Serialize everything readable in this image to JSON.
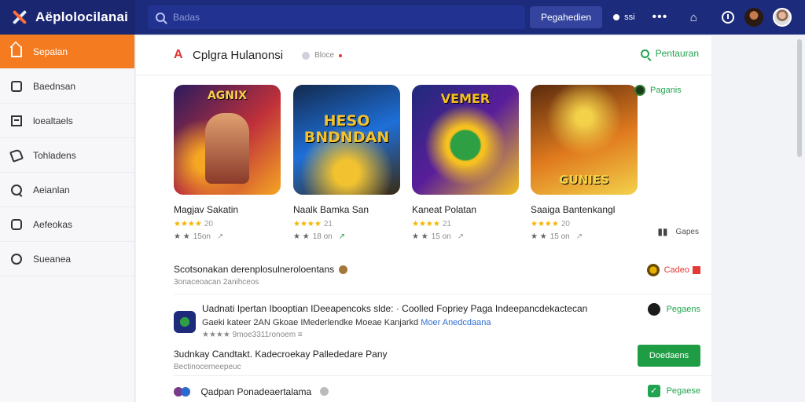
{
  "app": {
    "title": "Aëplolocilanai"
  },
  "search": {
    "placeholder": "Badas"
  },
  "topbar": {
    "primary_button": "Pegahedien",
    "status_text": "ssi",
    "more": "•••"
  },
  "sidebar": {
    "items": [
      {
        "label": "Sepalan",
        "icon": "home-icon",
        "active": true
      },
      {
        "label": "Baednsan",
        "icon": "grid-icon"
      },
      {
        "label": "loealtaels",
        "icon": "box-icon"
      },
      {
        "label": "Tohladens",
        "icon": "tag-icon"
      },
      {
        "label": "Aeianlan",
        "icon": "search-icon"
      },
      {
        "label": "Aefeokas",
        "icon": "pin-icon"
      },
      {
        "label": "Sueanea",
        "icon": "coin-icon"
      }
    ]
  },
  "panel": {
    "title": "Cplgra Hulanonsi",
    "sort_label": "Bloce",
    "header_link": "Pentauran",
    "right_badge": "Paganis",
    "right_meta": "Gapes"
  },
  "cards": [
    {
      "image_text": "AGNIX",
      "title": "Magjav Sakatin",
      "rating": "★★★★",
      "rating_text": "20",
      "meta": "15on",
      "colors": [
        "#2a1b5e",
        "#c0303a",
        "#f5a623"
      ]
    },
    {
      "image_text": "HESO BNDNDAN",
      "title": "Naalk Bamka San",
      "rating": "★★★★",
      "rating_text": "21",
      "meta": "18 on",
      "colors": [
        "#132a4d",
        "#1e6fd9",
        "#f2c230"
      ]
    },
    {
      "image_text": "VEMER",
      "title": "Kaneat Polatan",
      "rating": "★★★★",
      "rating_text": "21",
      "meta": "15 on",
      "colors": [
        "#1e2a7a",
        "#2ea043",
        "#f5c020"
      ]
    },
    {
      "image_text": "GUNIES",
      "title": "Saaiga Bantenkangl",
      "rating": "★★★★",
      "rating_text": "20",
      "meta": "15 on",
      "colors": [
        "#5a2a0e",
        "#e07a1e",
        "#f3d24a"
      ]
    }
  ],
  "section": {
    "title": "Scotsonakan derenplosulneroloentans",
    "subtitle": "3onaceoacan 2anihceos",
    "badge": "Cadeo"
  },
  "rows": [
    {
      "line1": "Uadnati Ipertan Ibooptian IDeeapencoks slde: · Coolled Fopriey Paga Indeepancdekactecan",
      "line2_a": "Gaeki kateer 2AN Gkoae IMederlendke Moeae Kanjarkd",
      "line2_b": "Moer Anedcdaana",
      "line3": "★★★★  9moe3311ronoem ≡",
      "action": "Pegaens"
    },
    {
      "line1": "3udnkay Candtakt. Kadecroekay Pallededare Pany",
      "line2_a": "Bectinocerneepeuc",
      "action": "Doedaens"
    },
    {
      "line1": "Qadpan Ponadeaertalama",
      "action": "Pegaese"
    }
  ],
  "colors": {
    "topbar": "#1d2b7c",
    "accent": "#f47b20",
    "green": "#1f9d45"
  }
}
